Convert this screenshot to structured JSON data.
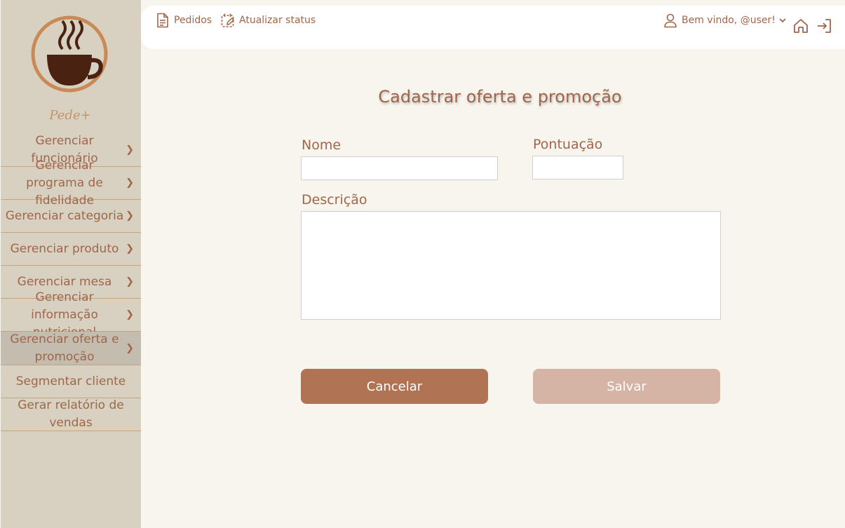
{
  "brand": {
    "name": "Pede+"
  },
  "sidebar": {
    "items": [
      {
        "label": "Gerenciar funcionário",
        "chevron": true,
        "active": false
      },
      {
        "label": "Gerenciar programa de fidelidade",
        "chevron": true,
        "active": false
      },
      {
        "label": "Gerenciar categoria",
        "chevron": true,
        "active": false
      },
      {
        "label": "Gerenciar produto",
        "chevron": true,
        "active": false
      },
      {
        "label": "Gerenciar mesa",
        "chevron": true,
        "active": false
      },
      {
        "label": "Gerenciar informação nutricional",
        "chevron": true,
        "active": false
      },
      {
        "label": "Gerenciar oferta e promoção",
        "chevron": true,
        "active": true
      },
      {
        "label": "Segmentar cliente",
        "chevron": false,
        "active": false
      },
      {
        "label": "Gerar relatório de vendas",
        "chevron": false,
        "active": false
      }
    ]
  },
  "topbar": {
    "orders_label": "Pedidos",
    "update_status_label": "Atualizar status",
    "welcome_label": "Bem vindo, @user!"
  },
  "form": {
    "title": "Cadastrar oferta e promoção",
    "name_label": "Nome",
    "name_value": "",
    "points_label": "Pontuação",
    "points_value": "",
    "description_label": "Descrição",
    "description_value": "",
    "cancel_label": "Cancelar",
    "save_label": "Salvar"
  },
  "colors": {
    "accent": "#a0664a",
    "sidebar_bg": "#d8d1c1",
    "page_bg": "#f8f4ee",
    "cancel_button": "#b07354",
    "save_button": "#d5b3a5"
  },
  "icons": {
    "logo": "coffee-cup-icon",
    "orders": "document-icon",
    "update_status": "calendar-edit-icon",
    "user": "user-icon",
    "dropdown": "chevron-down-icon",
    "home": "home-icon",
    "logout": "logout-icon",
    "menu_chevron": "chevron-right-icon"
  }
}
